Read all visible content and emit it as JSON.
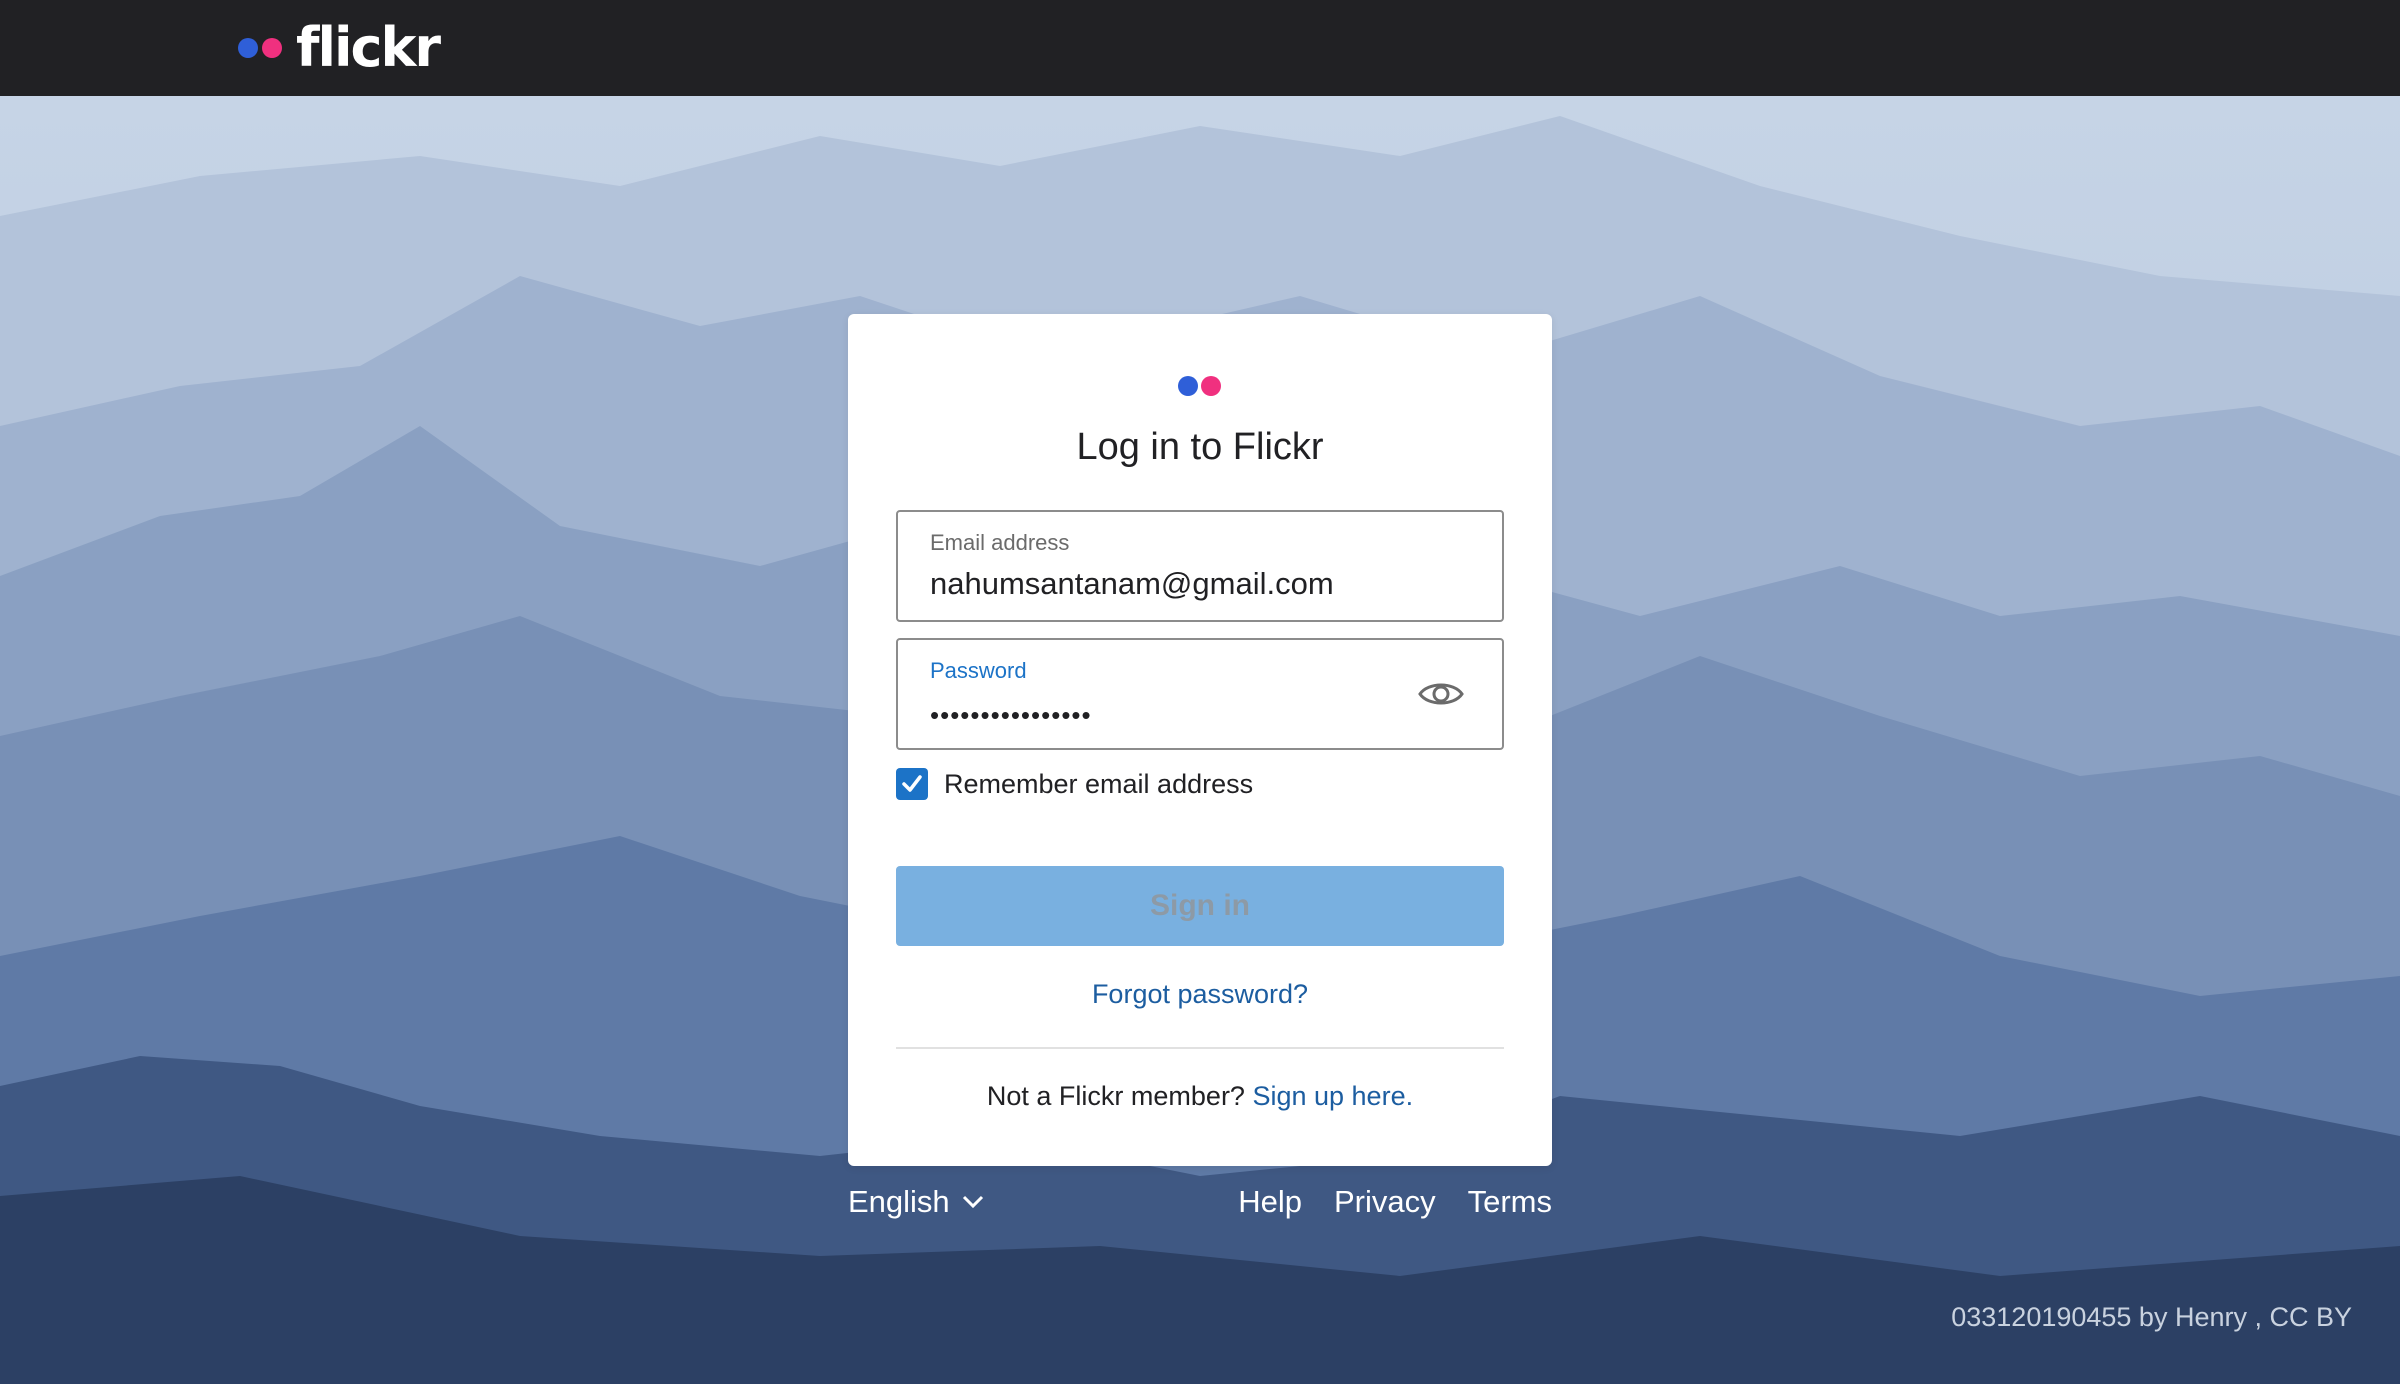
{
  "header": {
    "logo_text": "flickr",
    "colors": {
      "blue": "#2f5fd8",
      "pink": "#f0307f",
      "bar": "#212124"
    }
  },
  "login": {
    "title": "Log in to Flickr",
    "email": {
      "label": "Email address",
      "value": "nahumsantanam@gmail.com"
    },
    "password": {
      "label": "Password",
      "masked_value": "••••••••••••••••",
      "toggle_icon": "eye-icon"
    },
    "remember": {
      "label": "Remember email address",
      "checked": true
    },
    "signin_label": "Sign in",
    "forgot_label": "Forgot password?",
    "not_member_text": "Not a Flickr member?",
    "signup_label": "Sign up here."
  },
  "footer": {
    "language": "English",
    "links": {
      "help": "Help",
      "privacy": "Privacy",
      "terms": "Terms"
    }
  },
  "photo_credit": "033120190455 by Henry , CC BY"
}
